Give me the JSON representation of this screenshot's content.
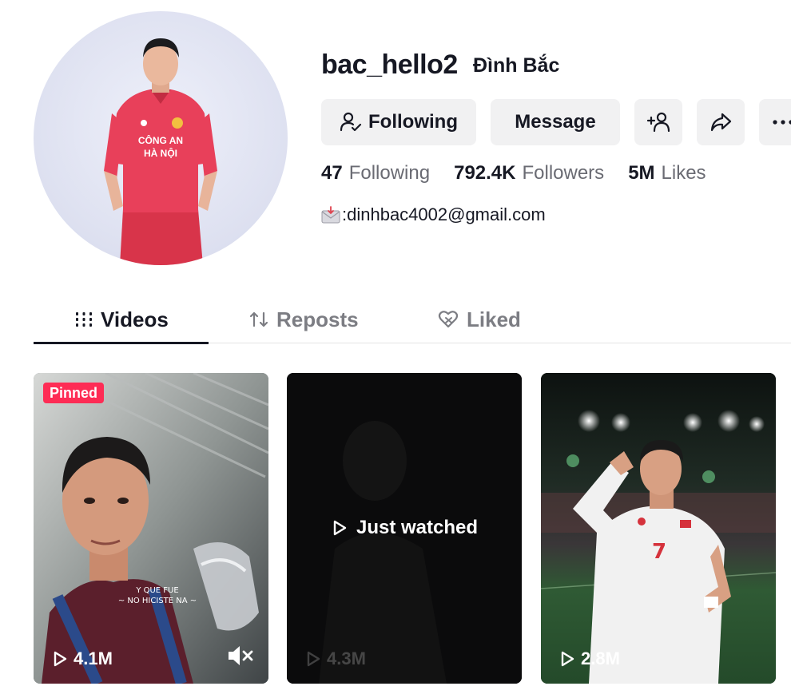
{
  "profile": {
    "username": "bac_hello2",
    "nickname": "Đình Bắc",
    "buttons": {
      "following": "Following",
      "message": "Message"
    },
    "stats": [
      {
        "value": "47",
        "label": "Following"
      },
      {
        "value": "792.4K",
        "label": "Followers"
      },
      {
        "value": "5M",
        "label": "Likes"
      }
    ],
    "bio": ":dinhbac4002@gmail.com",
    "jersey_text": [
      "CÔNG AN",
      "HÀ NỘI"
    ]
  },
  "tabs": [
    {
      "label": "Videos",
      "icon": "grid-icon",
      "active": true
    },
    {
      "label": "Reposts",
      "icon": "repost-icon",
      "active": false
    },
    {
      "label": "Liked",
      "icon": "heart-icon",
      "active": false
    }
  ],
  "videos": [
    {
      "views": "4.1M",
      "badge": "Pinned",
      "caption": [
        "Y QUE FUE",
        "~ NO HICISTE NA ~"
      ],
      "muted": true
    },
    {
      "views": "4.3M",
      "overlay": "Just watched"
    },
    {
      "views": "2.8M"
    }
  ],
  "colors": {
    "accent": "#fe2c55",
    "text": "#161823",
    "secondary": "#6a6b73",
    "button_bg": "#f1f1f2"
  }
}
